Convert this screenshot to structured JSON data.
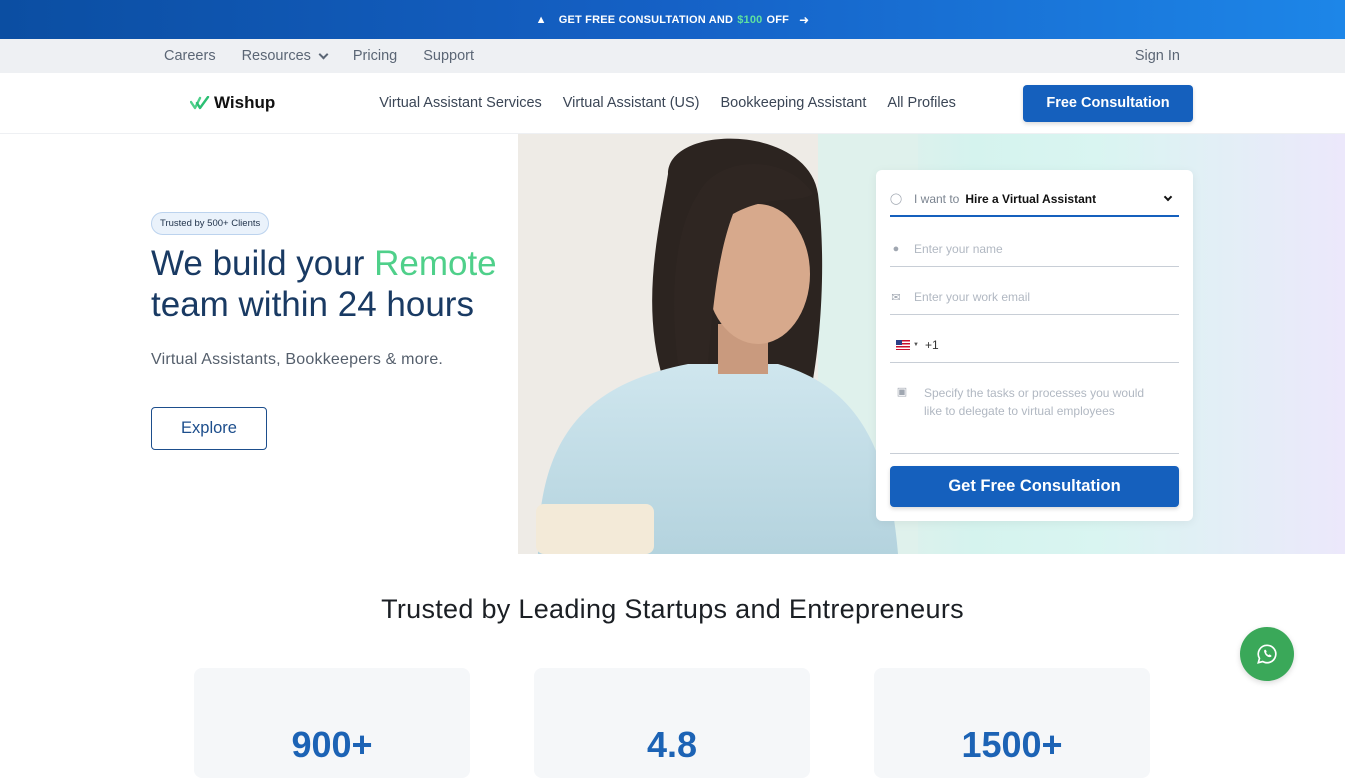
{
  "promo": {
    "text": "GET FREE CONSULTATION AND",
    "amount": "$100",
    "suffix": "OFF"
  },
  "util": {
    "links": [
      {
        "label": "Careers"
      },
      {
        "label": "Resources"
      },
      {
        "label": "Pricing"
      },
      {
        "label": "Support"
      }
    ],
    "signin": "Sign In"
  },
  "nav": {
    "brand": "Wishup",
    "links": [
      "Virtual Assistant Services",
      "Virtual Assistant (US)",
      "Bookkeeping Assistant",
      "All Profiles"
    ],
    "cta": "Free Consultation"
  },
  "hero": {
    "badge": "Trusted by 500+ Clients",
    "headline_1": "We build your",
    "headline_highlight": "Remote",
    "headline_2": "team within 24 hours",
    "sub": "Virtual Assistants, Bookkeepers & more.",
    "explore": "Explore"
  },
  "form": {
    "select_label": "I want to",
    "select_value": "Hire a Virtual Assistant",
    "name_placeholder": "Enter your name",
    "email_placeholder": "Enter your work email",
    "phone_code": "+1",
    "tasks_placeholder": "Specify the tasks or processes you would like to delegate to virtual employees",
    "submit": "Get Free Consultation"
  },
  "trusted": {
    "title": "Trusted by Leading Startups and Entrepreneurs",
    "stats": [
      "900+",
      "4.8",
      "1500+"
    ]
  },
  "colors": {
    "primary": "#1560bd",
    "accent_green": "#4fd08a",
    "whatsapp": "#3aa859"
  }
}
